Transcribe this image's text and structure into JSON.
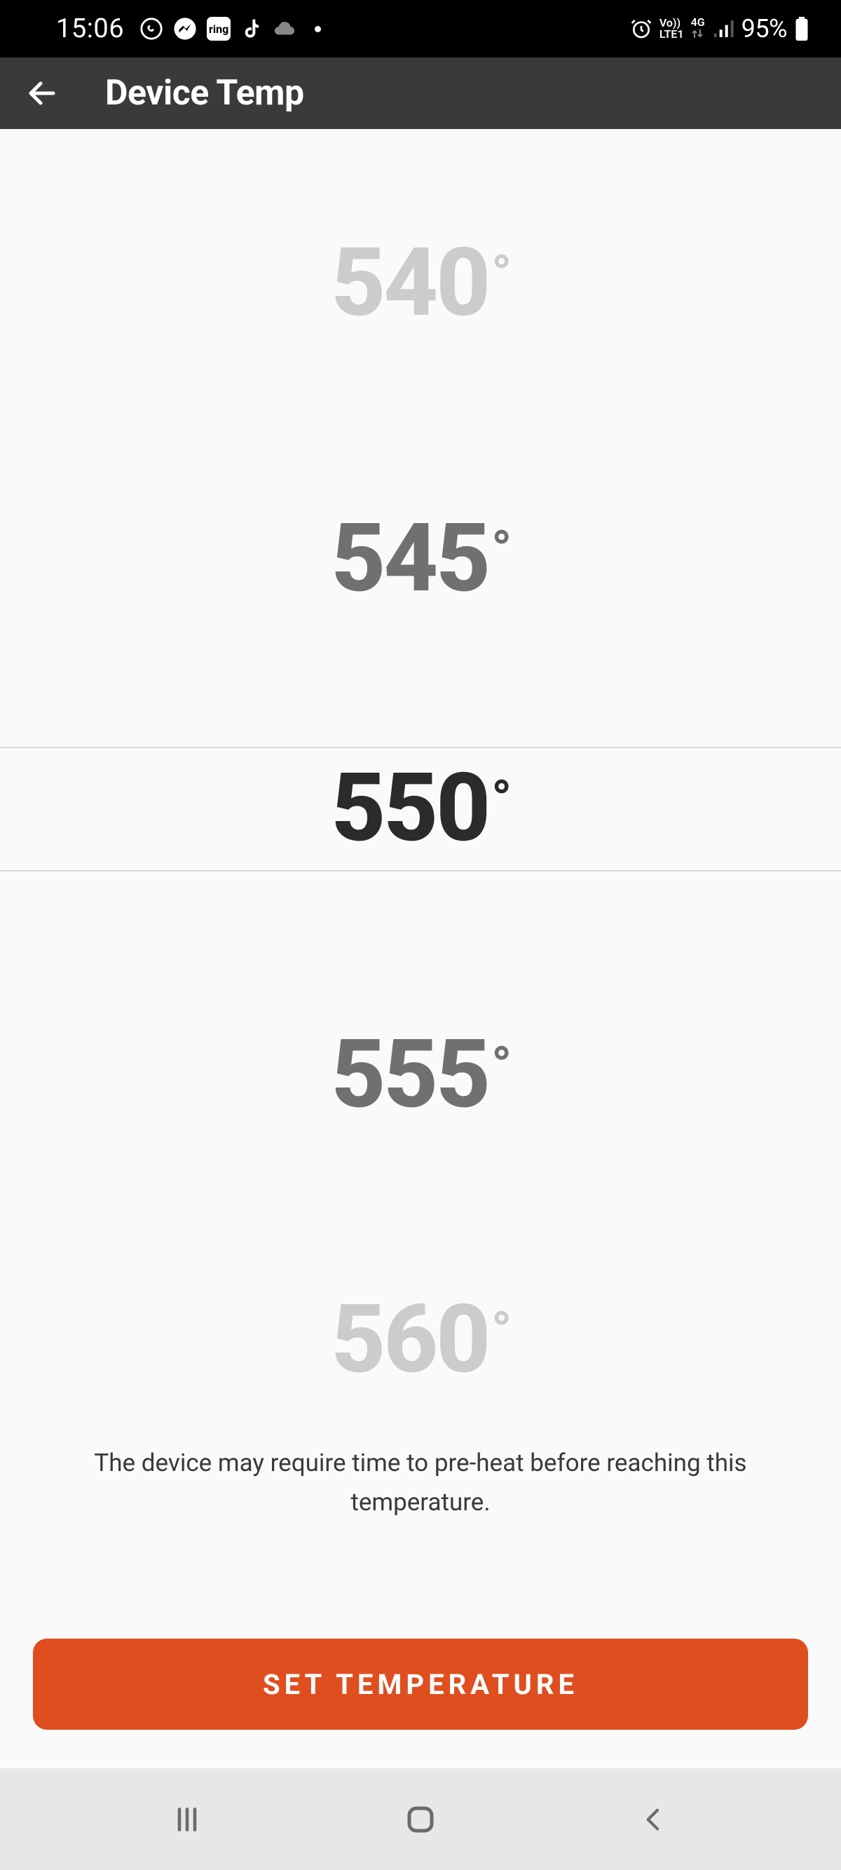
{
  "status": {
    "time": "15:06",
    "net_line1": "Vo))",
    "net_line2": "LTE1",
    "net_4g": "4G",
    "battery": "95%",
    "ring_label": "ring"
  },
  "header": {
    "title": "Device Temp"
  },
  "picker": {
    "values": [
      "540",
      "545",
      "550",
      "555",
      "560"
    ],
    "degree_symbol": "°"
  },
  "helper_text": "The device may require time to pre-heat before reaching this temperature.",
  "button_label": "SET TEMPERATURE"
}
